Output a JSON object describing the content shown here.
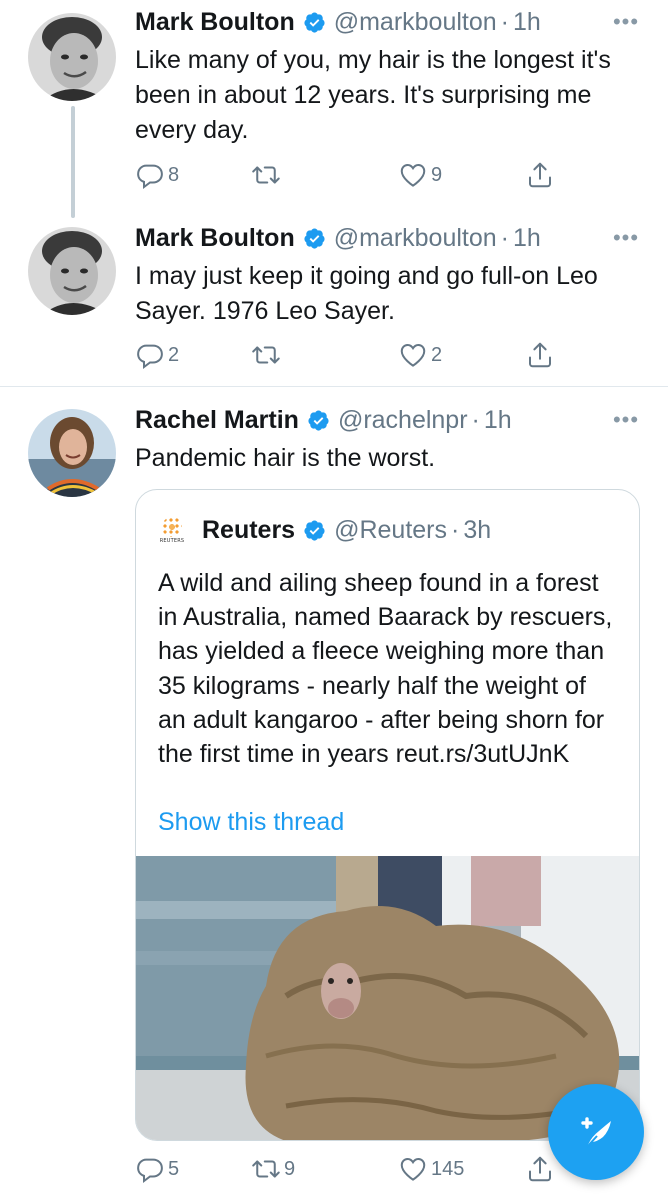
{
  "tweets": [
    {
      "name": "Mark Boulton",
      "handle": "@markboulton",
      "time": "1h",
      "text": "Like many of you, my hair is the longest it's been in about 12 years. It's surprising me every day.",
      "replies": "8",
      "retweets": "",
      "likes": "9"
    },
    {
      "name": "Mark Boulton",
      "handle": "@markboulton",
      "time": "1h",
      "text": "I may just keep it going and go full-on Leo Sayer. 1976 Leo Sayer.",
      "replies": "2",
      "retweets": "",
      "likes": "2"
    },
    {
      "name": "Rachel Martin",
      "handle": "@rachelnpr",
      "time": "1h",
      "text": "Pandemic hair is the worst.",
      "replies": "5",
      "retweets": "9",
      "likes": "145",
      "quote": {
        "logo_text": "REUTERS",
        "name": "Reuters",
        "handle": "@Reuters",
        "time": "3h",
        "text": "A wild and ailing sheep found in a forest in Australia, named Baarack by rescuers, has yielded a fleece weighing more than 35 kilograms - nearly half the weight of an adult kangaroo - after being shorn for the first time in years reut.rs/3utUJnK",
        "show_thread": "Show this thread"
      }
    }
  ],
  "separator": "·",
  "colors": {
    "accent": "#1da1f2",
    "link": "#1d9bf0",
    "muted": "#657786",
    "verified": "#1d9bf0"
  },
  "icons": [
    "reply-icon",
    "retweet-icon",
    "like-icon",
    "share-icon",
    "more-icon",
    "verified-badge-icon",
    "compose-tweet-icon"
  ]
}
